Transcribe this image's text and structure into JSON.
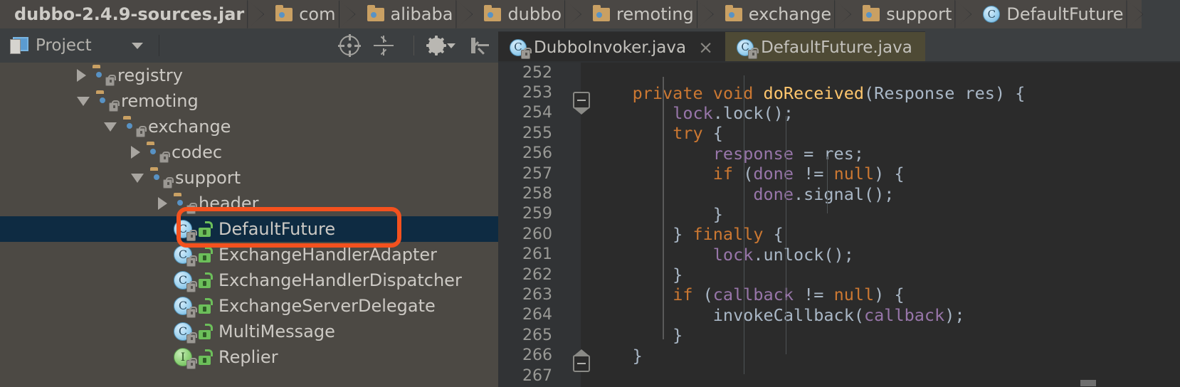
{
  "breadcrumb": {
    "items": [
      {
        "label": "dubbo-2.4.9-sources.jar",
        "icon": "jar-icon"
      },
      {
        "label": "com",
        "icon": "folder-icon"
      },
      {
        "label": "alibaba",
        "icon": "folder-icon"
      },
      {
        "label": "dubbo",
        "icon": "folder-icon"
      },
      {
        "label": "remoting",
        "icon": "folder-icon"
      },
      {
        "label": "exchange",
        "icon": "folder-icon"
      },
      {
        "label": "support",
        "icon": "folder-icon"
      },
      {
        "label": "DefaultFuture",
        "icon": "class-icon",
        "icon_letter": "C"
      }
    ]
  },
  "tool_panel": {
    "title": "Project",
    "title_icon": "project-icon",
    "dropdown_icon": "chevron-down-icon",
    "buttons": [
      {
        "name": "select-opened-file-icon",
        "tooltip": "Select Opened File"
      },
      {
        "name": "collapse-all-icon",
        "tooltip": "Collapse All"
      },
      {
        "name": "settings-gear-icon",
        "tooltip": "Settings"
      },
      {
        "name": "hide-panel-icon",
        "tooltip": "Hide"
      }
    ]
  },
  "editor_tabs": [
    {
      "label": "DubboInvoker.java",
      "icon": "java-class-icon",
      "icon_letter": "C",
      "active": false,
      "close": "×"
    },
    {
      "label": "DefaultFuture.java",
      "icon": "java-class-icon",
      "icon_letter": "C",
      "active": true,
      "close": ""
    }
  ],
  "project_tree": [
    {
      "label": "registry",
      "indent": 1,
      "toggle": "collapsed",
      "icon": "folder-icon",
      "selected": false
    },
    {
      "label": "remoting",
      "indent": 1,
      "toggle": "expanded",
      "icon": "folder-icon",
      "selected": false
    },
    {
      "label": "exchange",
      "indent": 2,
      "toggle": "expanded",
      "icon": "folder-icon",
      "selected": false
    },
    {
      "label": "codec",
      "indent": 3,
      "toggle": "collapsed",
      "icon": "folder-icon",
      "selected": false
    },
    {
      "label": "support",
      "indent": 3,
      "toggle": "expanded",
      "icon": "folder-icon",
      "selected": false
    },
    {
      "label": "header",
      "indent": 4,
      "toggle": "collapsed",
      "icon": "folder-icon",
      "selected": false
    },
    {
      "label": "DefaultFuture",
      "indent": 4,
      "toggle": "none",
      "icon": "class-icon",
      "icon_letter": "C",
      "selected": true
    },
    {
      "label": "ExchangeHandlerAdapter",
      "indent": 4,
      "toggle": "none",
      "icon": "class-icon",
      "icon_letter": "C",
      "selected": false
    },
    {
      "label": "ExchangeHandlerDispatcher",
      "indent": 4,
      "toggle": "none",
      "icon": "class-icon",
      "icon_letter": "C",
      "selected": false
    },
    {
      "label": "ExchangeServerDelegate",
      "indent": 4,
      "toggle": "none",
      "icon": "class-icon",
      "icon_letter": "C",
      "selected": false
    },
    {
      "label": "MultiMessage",
      "indent": 4,
      "toggle": "none",
      "icon": "class-icon",
      "icon_letter": "C",
      "selected": false
    },
    {
      "label": "Replier",
      "indent": 4,
      "toggle": "none",
      "icon": "interface-icon",
      "icon_letter": "I",
      "selected": false
    }
  ],
  "annotation": {
    "shape": "rounded-rectangle",
    "color": "#f4511e",
    "targets": "DefaultFuture"
  },
  "code": {
    "language": "java",
    "first_visible_line": 252,
    "lines": [
      {
        "num": 252,
        "tokens": [],
        "fold": "none"
      },
      {
        "num": 253,
        "fold": "start",
        "tokens": [
          {
            "t": "    ",
            "c": "pln"
          },
          {
            "t": "private",
            "c": "kw"
          },
          {
            "t": " ",
            "c": "pln"
          },
          {
            "t": "void",
            "c": "kw"
          },
          {
            "t": " ",
            "c": "pln"
          },
          {
            "t": "doReceived",
            "c": "mth"
          },
          {
            "t": "(Response res) {",
            "c": "pln"
          }
        ]
      },
      {
        "num": 254,
        "fold": "none",
        "tokens": [
          {
            "t": "        ",
            "c": "pln"
          },
          {
            "t": "lock",
            "c": "fld"
          },
          {
            "t": ".lock();",
            "c": "pln"
          }
        ]
      },
      {
        "num": 255,
        "fold": "none",
        "tokens": [
          {
            "t": "        ",
            "c": "pln"
          },
          {
            "t": "try",
            "c": "kw"
          },
          {
            "t": " {",
            "c": "pln"
          }
        ]
      },
      {
        "num": 256,
        "fold": "none",
        "tokens": [
          {
            "t": "            ",
            "c": "pln"
          },
          {
            "t": "response",
            "c": "fld"
          },
          {
            "t": " = res;",
            "c": "pln"
          }
        ]
      },
      {
        "num": 257,
        "fold": "none",
        "tokens": [
          {
            "t": "            ",
            "c": "pln"
          },
          {
            "t": "if",
            "c": "kw"
          },
          {
            "t": " (",
            "c": "pln"
          },
          {
            "t": "done",
            "c": "fld"
          },
          {
            "t": " != ",
            "c": "pln"
          },
          {
            "t": "null",
            "c": "kw"
          },
          {
            "t": ") {",
            "c": "pln"
          }
        ]
      },
      {
        "num": 258,
        "fold": "none",
        "tokens": [
          {
            "t": "                ",
            "c": "pln"
          },
          {
            "t": "done",
            "c": "fld"
          },
          {
            "t": ".signal();",
            "c": "pln"
          }
        ]
      },
      {
        "num": 259,
        "fold": "none",
        "tokens": [
          {
            "t": "            }",
            "c": "pln"
          }
        ]
      },
      {
        "num": 260,
        "fold": "none",
        "tokens": [
          {
            "t": "        } ",
            "c": "pln"
          },
          {
            "t": "finally",
            "c": "kw"
          },
          {
            "t": " {",
            "c": "pln"
          }
        ]
      },
      {
        "num": 261,
        "fold": "none",
        "tokens": [
          {
            "t": "            ",
            "c": "pln"
          },
          {
            "t": "lock",
            "c": "fld"
          },
          {
            "t": ".unlock();",
            "c": "pln"
          }
        ]
      },
      {
        "num": 262,
        "fold": "none",
        "tokens": [
          {
            "t": "        }",
            "c": "pln"
          }
        ]
      },
      {
        "num": 263,
        "fold": "none",
        "tokens": [
          {
            "t": "        ",
            "c": "pln"
          },
          {
            "t": "if",
            "c": "kw"
          },
          {
            "t": " (",
            "c": "pln"
          },
          {
            "t": "callback",
            "c": "fld"
          },
          {
            "t": " != ",
            "c": "pln"
          },
          {
            "t": "null",
            "c": "kw"
          },
          {
            "t": ") {",
            "c": "pln"
          }
        ]
      },
      {
        "num": 264,
        "fold": "none",
        "tokens": [
          {
            "t": "            invokeCallback(",
            "c": "pln"
          },
          {
            "t": "callback",
            "c": "fld"
          },
          {
            "t": ");",
            "c": "pln"
          }
        ]
      },
      {
        "num": 265,
        "fold": "none",
        "tokens": [
          {
            "t": "        }",
            "c": "pln"
          }
        ]
      },
      {
        "num": 266,
        "fold": "end",
        "tokens": [
          {
            "t": "    }",
            "c": "pln"
          }
        ]
      },
      {
        "num": 267,
        "fold": "none",
        "tokens": []
      }
    ]
  },
  "colors": {
    "breadcrumb_bg": "#4a4744",
    "panel_bg": "#3c3f41",
    "tree_bg": "#4c4944",
    "tree_selection": "#0e2b42",
    "editor_bg": "#2b2b2b",
    "gutter_bg": "#313335",
    "tab_active_bg": "#4e4a35",
    "tab_inactive_bg": "#2b2b2b",
    "annotation": "#f4511e",
    "keyword": "#cc7832",
    "method": "#ffc66d",
    "field": "#9876aa",
    "plain": "#a9b7c6",
    "folder": "#c9a063"
  }
}
